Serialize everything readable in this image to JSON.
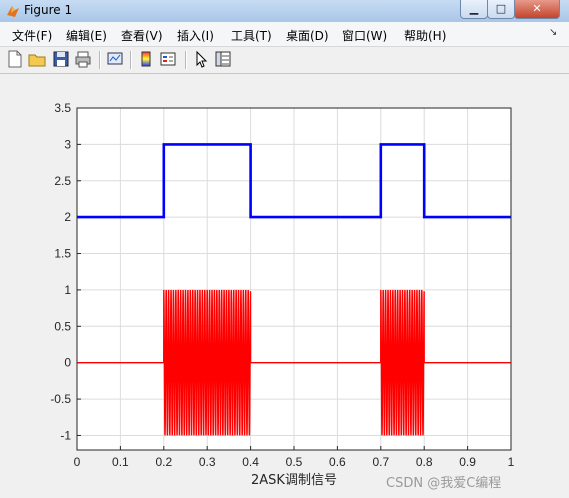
{
  "window": {
    "title": "Figure 1",
    "minimize_glyph": "▁",
    "maximize_glyph": "□",
    "close_glyph": "✕"
  },
  "menu": {
    "items": [
      "文件(F)",
      "编辑(E)",
      "查看(V)",
      "插入(I)",
      "工具(T)",
      "桌面(D)",
      "窗口(W)",
      "帮助(H)"
    ],
    "overflow_glyph": "↘"
  },
  "toolbar": {
    "icons": [
      "new-figure-icon",
      "open-file-icon",
      "save-icon",
      "print-icon",
      "link-plot-icon",
      "insert-colorbar-icon",
      "insert-legend-icon",
      "edit-plot-icon",
      "property-inspector-icon"
    ]
  },
  "chart_data": {
    "type": "line",
    "title": "",
    "xlabel": "2ASK调制信号",
    "ylabel": "",
    "xlim": [
      0,
      1
    ],
    "ylim": [
      -1.2,
      3.5
    ],
    "xticks": [
      "0",
      "0.1",
      "0.2",
      "0.3",
      "0.4",
      "0.5",
      "0.6",
      "0.7",
      "0.8",
      "0.9",
      "1"
    ],
    "yticks": [
      "-1",
      "-0.5",
      "0",
      "0.5",
      "1",
      "1.5",
      "2",
      "2.5",
      "3",
      "3.5"
    ],
    "grid": true,
    "series": [
      {
        "color": "#0000ff",
        "x": [
          0,
          0.2,
          0.2,
          0.4,
          0.4,
          0.7,
          0.7,
          0.8,
          0.8,
          1.0
        ],
        "y": [
          2,
          2,
          3,
          3,
          2,
          2,
          3,
          3,
          2,
          2
        ]
      },
      {
        "color": "#ff0000",
        "description_segments": [
          {
            "x_start": 0,
            "x_end": 0.2,
            "amplitude": 0
          },
          {
            "x_start": 0.2,
            "x_end": 0.4,
            "amplitude": 1
          },
          {
            "x_start": 0.4,
            "x_end": 0.7,
            "amplitude": 0
          },
          {
            "x_start": 0.7,
            "x_end": 0.8,
            "amplitude": 1
          },
          {
            "x_start": 0.8,
            "x_end": 1.0,
            "amplitude": 0
          }
        ]
      }
    ]
  },
  "watermark": "CSDN @我爱C编程"
}
